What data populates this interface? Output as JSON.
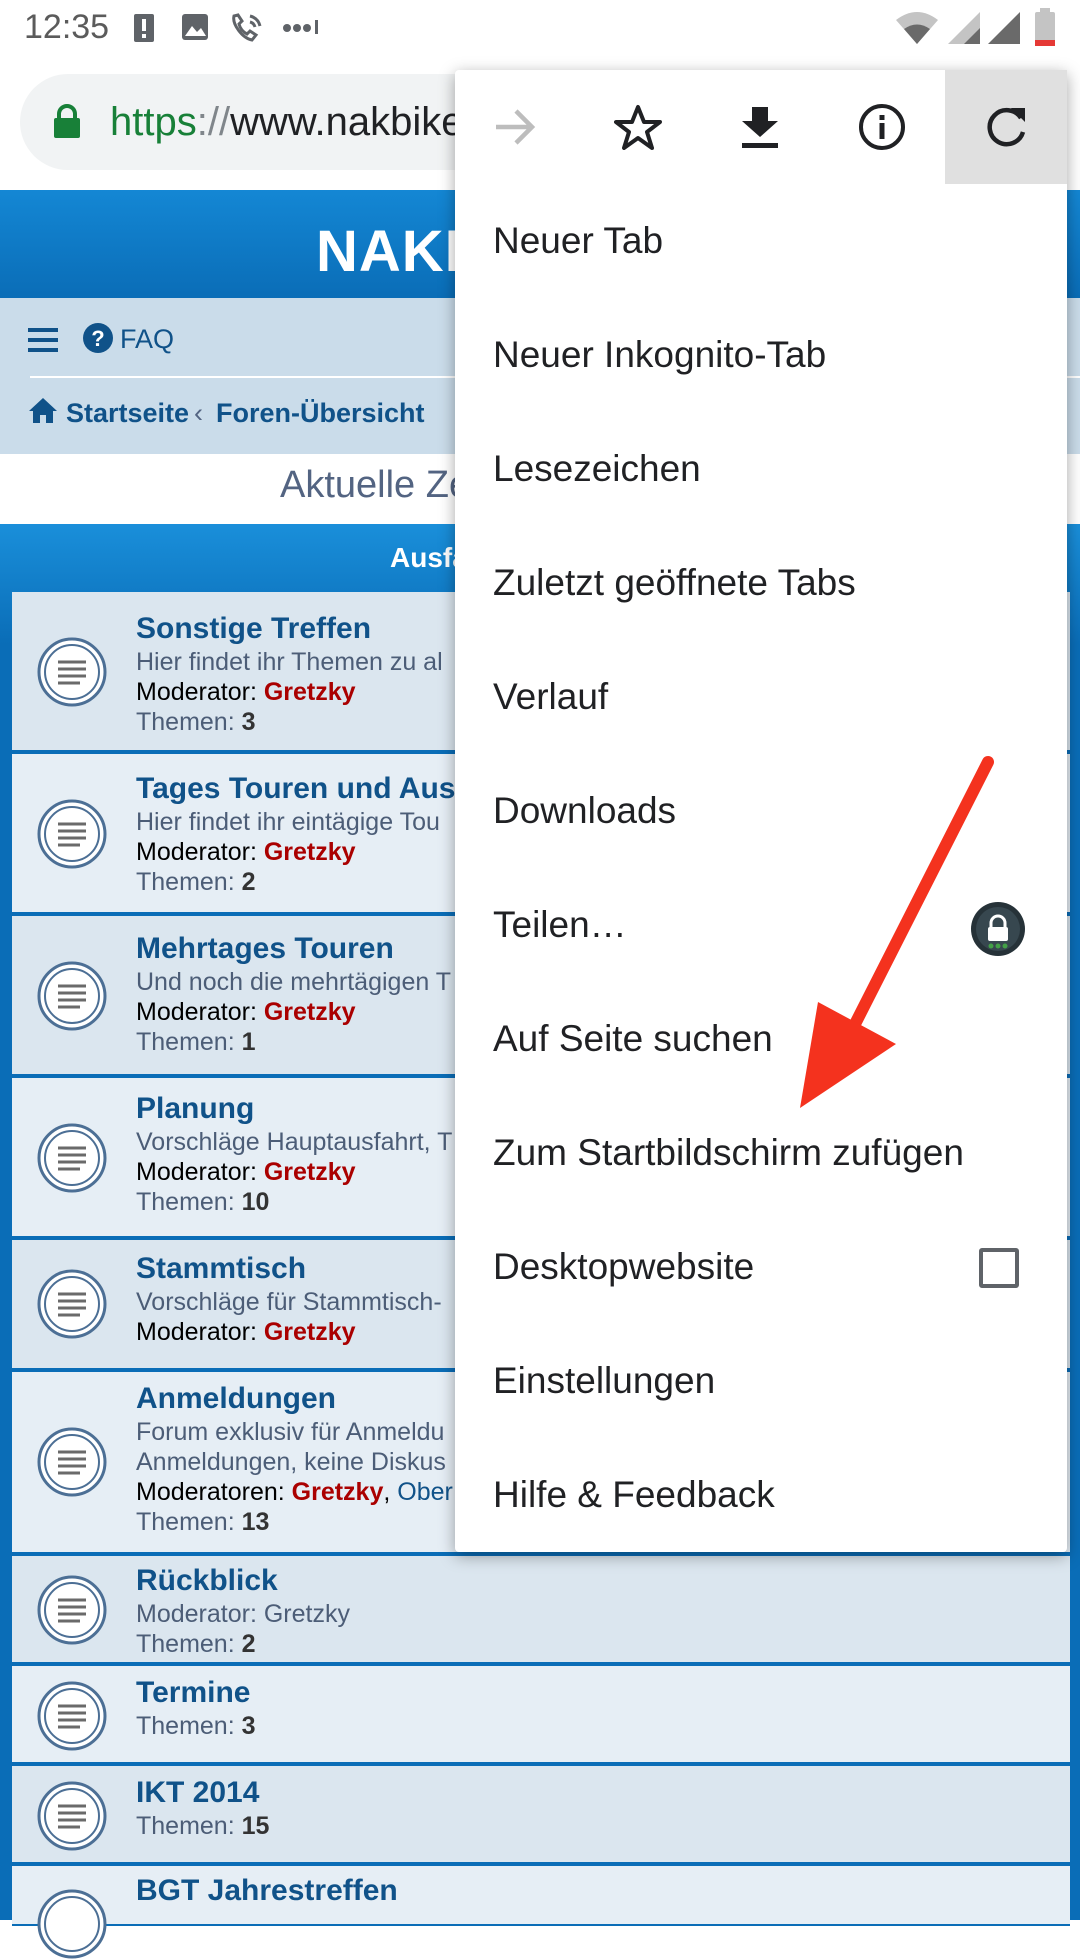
{
  "status_bar": {
    "time": "12:35"
  },
  "url_bar": {
    "scheme": "https",
    "separator": "://",
    "rest": "www.nakbike"
  },
  "site": {
    "title": "NAKE"
  },
  "nav": {
    "faq": "FAQ",
    "breadcrumb_home": "Startseite",
    "breadcrumb_sep": "‹",
    "breadcrumb_current": "Foren-Übersicht"
  },
  "page": {
    "title": "Aktuelle Ze",
    "forum_header": "Ausfa"
  },
  "forums": [
    {
      "title": "Sonstige Treffen",
      "desc": "Hier findet ihr Themen zu al",
      "mod_label": "Moderator:",
      "mod": "Gretzky",
      "count_label": "Themen:",
      "count": "3"
    },
    {
      "title": "Tages Touren und Ausf",
      "desc": "Hier findet ihr eintägige Tou",
      "mod_label": "Moderator:",
      "mod": "Gretzky",
      "count_label": "Themen:",
      "count": "2"
    },
    {
      "title": "Mehrtages Touren",
      "desc": "Und noch die mehrtägigen T",
      "mod_label": "Moderator:",
      "mod": "Gretzky",
      "count_label": "Themen:",
      "count": "1"
    },
    {
      "title": "Planung",
      "desc": "Vorschläge Hauptausfahrt, T",
      "mod_label": "Moderator:",
      "mod": "Gretzky",
      "count_label": "Themen:",
      "count": "10"
    },
    {
      "title": "Stammtisch",
      "desc": "Vorschläge für Stammtisch-",
      "mod_label": "Moderator:",
      "mod": "Gretzky"
    },
    {
      "title": "Anmeldungen",
      "desc": "Forum exklusiv für Anmeldu",
      "desc2": "Anmeldungen, keine Diskus",
      "mod_label": "Moderatoren:",
      "mod": "Gretzky",
      "mod_sep": ",",
      "mod2": "Ober",
      "count_label": "Themen:",
      "count": "13"
    },
    {
      "title": "Rückblick",
      "mod_line": "Moderator: Gretzky",
      "count_label": "Themen:",
      "count": "2"
    },
    {
      "title": "Termine",
      "count_label": "Themen:",
      "count": "3"
    },
    {
      "title": "IKT 2014",
      "count_label": "Themen:",
      "count": "15"
    },
    {
      "title": "BGT Jahrestreffen"
    }
  ],
  "menu": {
    "toolbar": [
      "forward-icon",
      "star-icon",
      "download-icon",
      "info-icon",
      "refresh-icon"
    ],
    "items": [
      "Neuer Tab",
      "Neuer Inkognito-Tab",
      "Lesezeichen",
      "Zuletzt geöffnete Tabs",
      "Verlauf",
      "Downloads",
      "Teilen…",
      "Auf Seite suchen",
      "Zum Startbildschirm zufügen",
      "Desktopwebsite",
      "Einstellungen",
      "Hilfe & Feedback"
    ],
    "desktop_site_checked": false
  },
  "colors": {
    "site_blue": "#0c73c1",
    "link_blue": "#105289",
    "moderator_red": "#aa0000",
    "annotation_arrow": "#f4321e"
  }
}
